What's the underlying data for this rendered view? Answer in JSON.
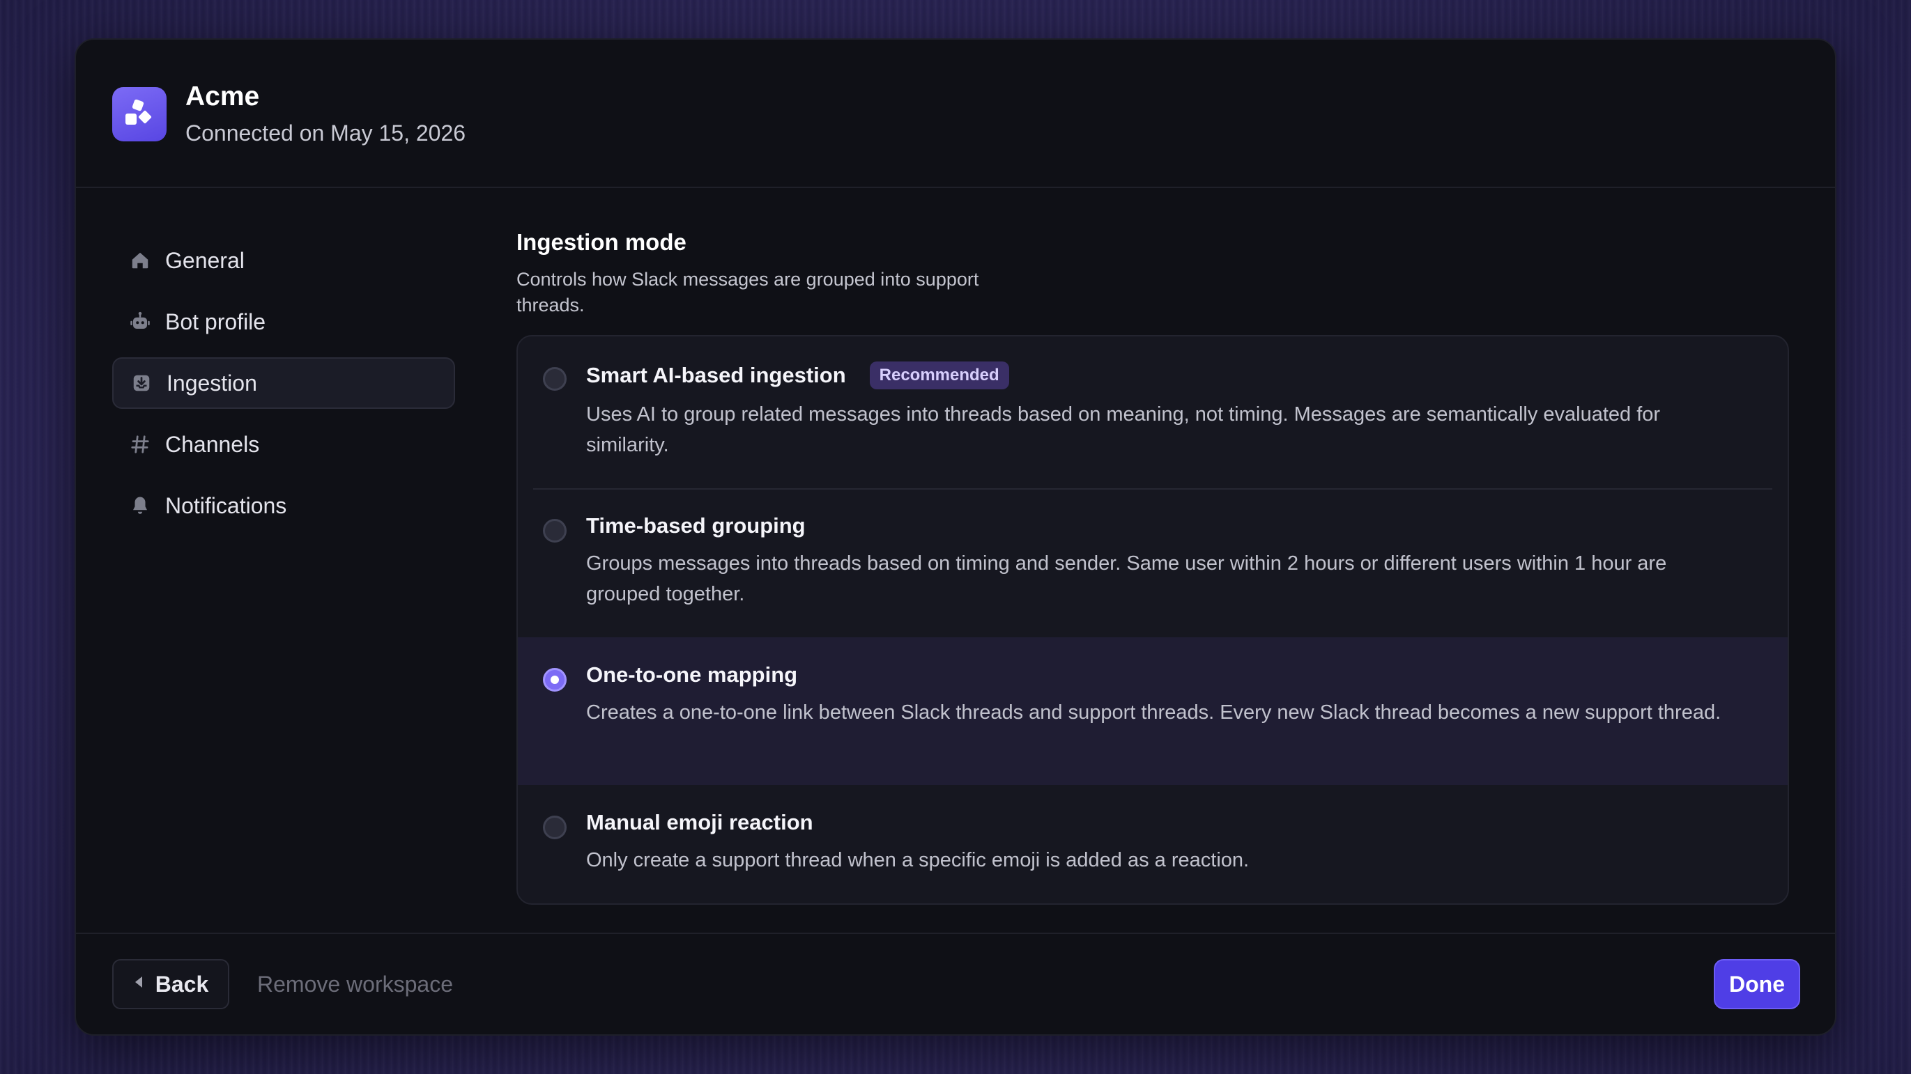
{
  "header": {
    "title": "Acme",
    "subtitle": "Connected on May 15, 2026",
    "logo_icon": "shapes-logo-icon"
  },
  "sidebar": {
    "items": [
      {
        "label": "General",
        "icon": "home-icon",
        "active": false
      },
      {
        "label": "Bot profile",
        "icon": "bot-icon",
        "active": false
      },
      {
        "label": "Ingestion",
        "icon": "inbox-download-icon",
        "active": true
      },
      {
        "label": "Channels",
        "icon": "hash-icon",
        "active": false
      },
      {
        "label": "Notifications",
        "icon": "bell-icon",
        "active": false
      }
    ]
  },
  "content": {
    "title": "Ingestion mode",
    "description": "Controls how Slack messages are grouped into support threads.",
    "options": [
      {
        "title": "Smart AI-based ingestion",
        "badge": "Recommended",
        "description": "Uses AI to group related messages into threads based on meaning, not timing. Messages are semantically evaluated for similarity.",
        "selected": false
      },
      {
        "title": "Time-based grouping",
        "description": "Groups messages into threads based on timing and sender. Same user within 2 hours or different users within 1 hour are grouped together.",
        "selected": false
      },
      {
        "title": "One-to-one mapping",
        "description": "Creates a one-to-one link between Slack threads and support threads. Every new Slack thread becomes a new support thread.",
        "selected": true
      },
      {
        "title": "Manual emoji reaction",
        "description": "Only create a support thread when a specific emoji is added as a reaction.",
        "selected": false
      }
    ]
  },
  "footer": {
    "back_label": "Back",
    "remove_label": "Remove workspace",
    "done_label": "Done"
  },
  "colors": {
    "accent": "#5846e3",
    "background": "#0f1016",
    "selected_row": "#1f1d33",
    "badge_bg": "#3a2f66"
  }
}
